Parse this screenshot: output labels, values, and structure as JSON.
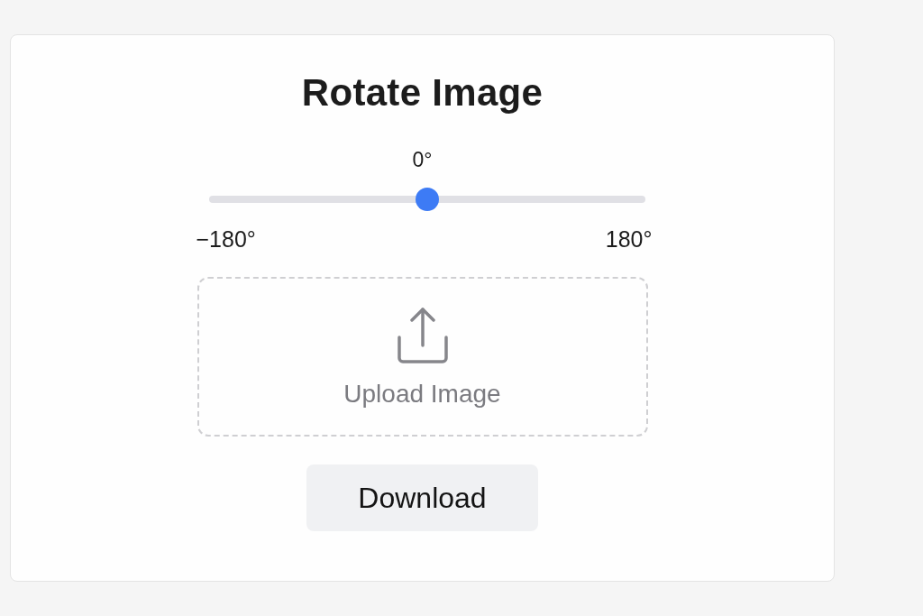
{
  "title": "Rotate Image",
  "rotation_slider": {
    "reading": "0°",
    "level": 0.5,
    "min_label": "−180°",
    "max_label": "180°"
  },
  "upload_area": {
    "label": "Upload Image"
  },
  "download_button": {
    "label": "Download"
  }
}
